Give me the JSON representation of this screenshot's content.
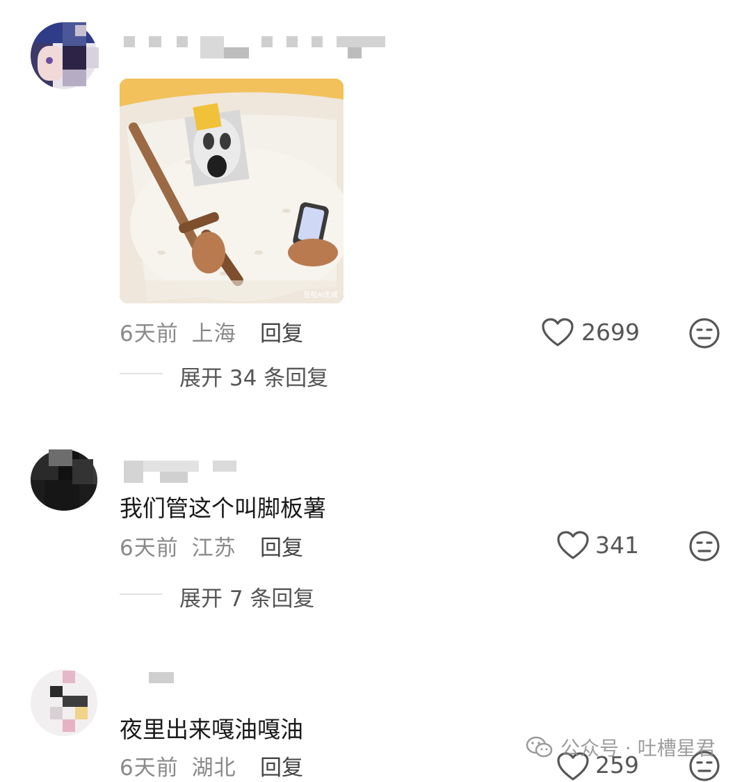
{
  "comments": [
    {
      "time": "6天前",
      "location": "上海",
      "reply_label": "回复",
      "likes": "2699",
      "expand_label": "展开 34 条回复",
      "image_caption": "豆包AI生成"
    },
    {
      "text": "我们管这个叫脚板薯",
      "time": "6天前",
      "location": "江苏",
      "reply_label": "回复",
      "likes": "341",
      "expand_label": "展开 7 条回复"
    },
    {
      "text": "夜里出来嘎油嘎油",
      "time": "6天前",
      "location": "湖北",
      "reply_label": "回复",
      "likes": "259"
    }
  ],
  "watermark": {
    "text": "公众号 · 吐槽星君",
    "icon": "wechat-icon"
  },
  "icons": {
    "like": "heart-outline-icon",
    "dislike": "meh-face-icon"
  },
  "colors": {
    "meta_gray": "#8a8a8a",
    "icon_gray": "#555555",
    "image_bg": "#e8a83b"
  }
}
